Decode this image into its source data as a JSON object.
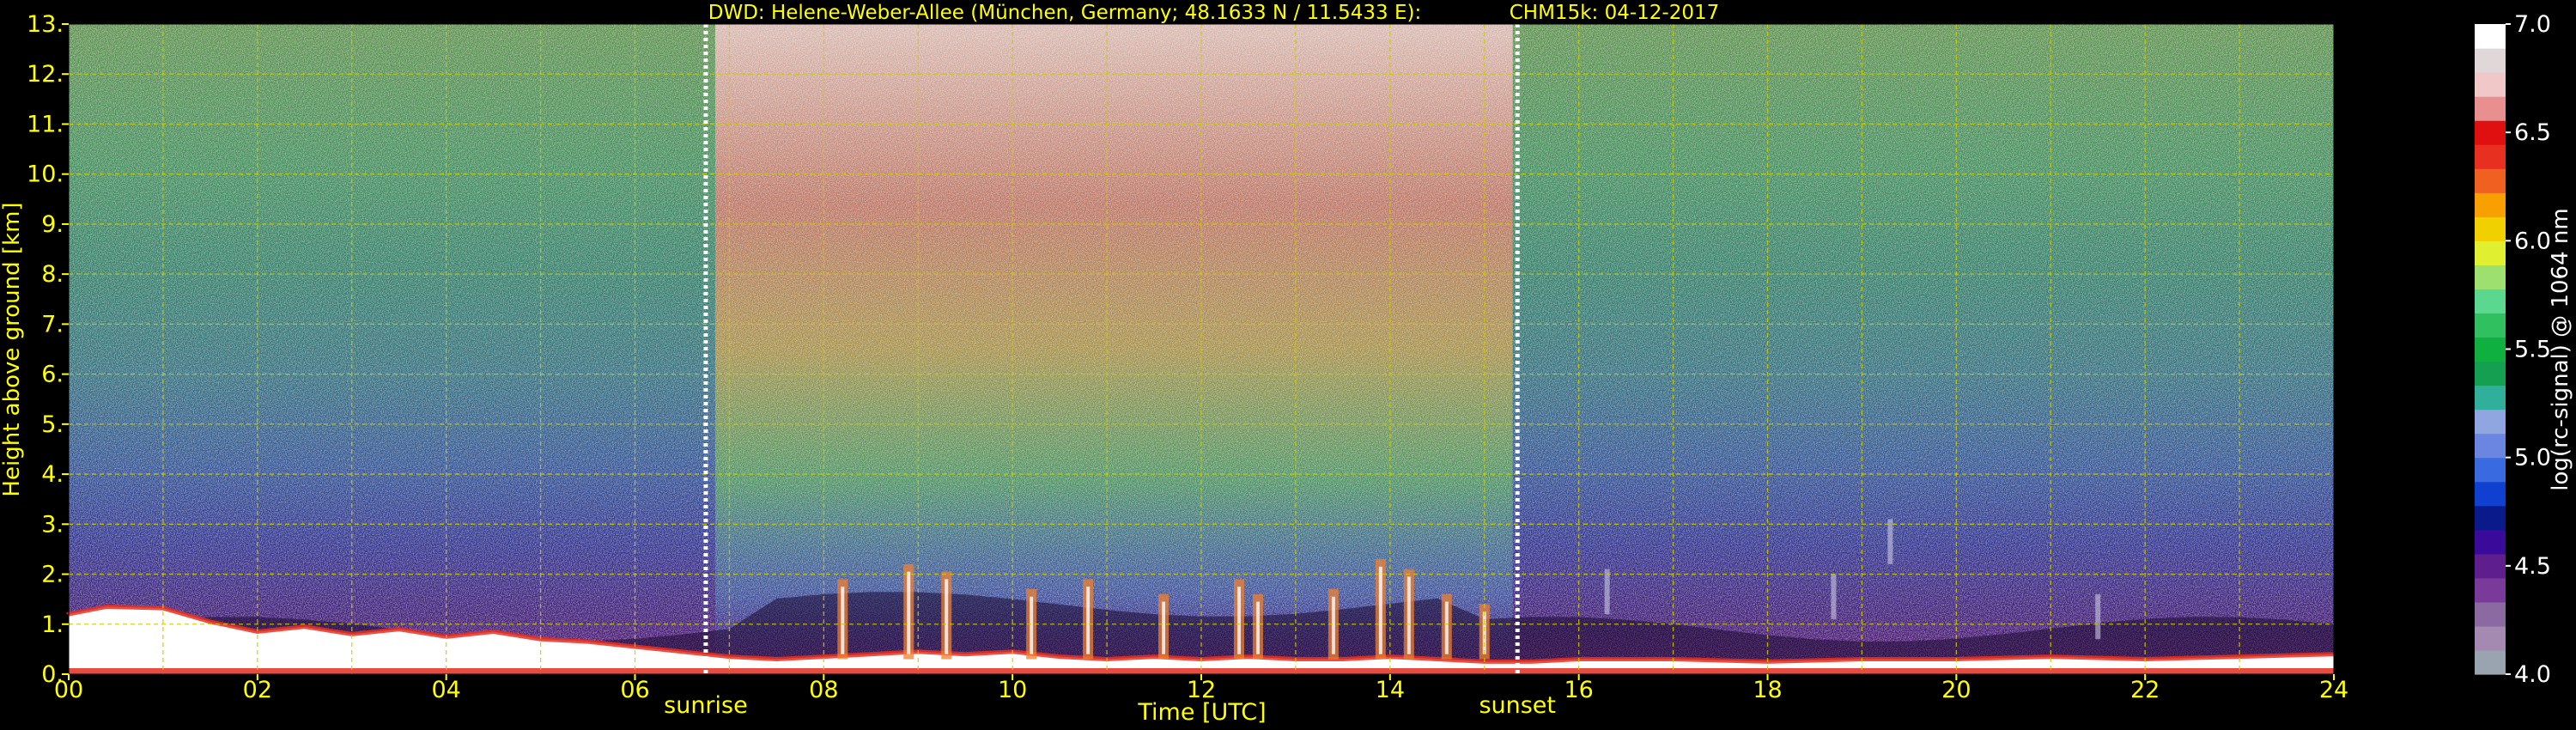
{
  "chart_data": {
    "type": "heatmap",
    "title_left": "DWD: Helene-Weber-Allee (München, Germany; 48.1633 N / 11.5433 E):",
    "title_right": "CHM15k: 04-12-2017",
    "xlabel": "Time [UTC]",
    "ylabel": "Height above ground [km]",
    "x_ticks": [
      "00",
      "02",
      "04",
      "06",
      "08",
      "10",
      "12",
      "14",
      "16",
      "18",
      "20",
      "22",
      "24"
    ],
    "y_ticks": [
      "0.",
      "1.",
      "2.",
      "3.",
      "4.",
      "5.",
      "6.",
      "7.",
      "8.",
      "9.",
      "10.",
      "11.",
      "12.",
      "13."
    ],
    "xlim": [
      0,
      24
    ],
    "ylim": [
      0,
      13
    ],
    "grid": true,
    "markers": [
      {
        "label": "sunrise",
        "x": 6.75
      },
      {
        "label": "sunset",
        "x": 15.35
      }
    ],
    "colorbar": {
      "label": "log(rc-signal) @ 1064 nm",
      "range": [
        4.0,
        7.0
      ],
      "ticks": [
        "4.0",
        "4.5",
        "5.0",
        "5.5",
        "6.0",
        "6.5",
        "7.0"
      ],
      "colors": [
        "#9aa4b0",
        "#a48ab0",
        "#8a6aa0",
        "#7a3a9a",
        "#5e1e8e",
        "#3a0a9a",
        "#0a1a8a",
        "#1040d0",
        "#3a6ae0",
        "#6a86e0",
        "#90a6e0",
        "#30b09a",
        "#14a050",
        "#10b040",
        "#30c060",
        "#5ad890",
        "#9ee070",
        "#e0f030",
        "#f0d000",
        "#f8a000",
        "#f06020",
        "#e83020",
        "#e01010",
        "#e89090",
        "#f0c8c8",
        "#e0d8d8",
        "#ffffff"
      ]
    }
  }
}
